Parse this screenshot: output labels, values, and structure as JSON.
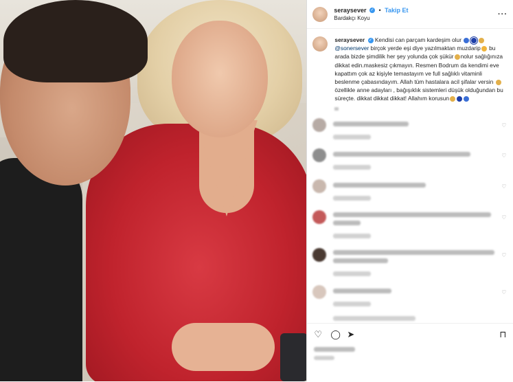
{
  "post": {
    "username": "seraysever",
    "follow_label": "Takip Et",
    "location": "Bardakçı Koyu",
    "caption_user": "seraysever",
    "caption_part1": "Kendisi can parçam kardeşim olur",
    "caption_mention": "@sonersever",
    "caption_part2": "birçok yerde eşi diye yazılmaktan muzdarip",
    "caption_part3": "bu arada bizde şimdilik her şey yolunda çok şükür",
    "caption_part4": "nolur sağlığınıza dikkat edin.maskesiz çıkmayın. Resmen Bodrum da kendimi eve kapattım çok az kişiyle temastayım ve full sağlıklı vitaminli beslenme çabasındayım. Allah tüm hastalara acil şifalar versin",
    "caption_part5": "özellikle anne adayları , bağışıklık sistemleri düşük olduğundan bu süreçte. dikkat dikkat dikkat! Allahım korusun"
  },
  "icons": {
    "more": "more-dots-icon",
    "verified": "verified-badge-icon",
    "like": "heart-icon",
    "comment": "comment-icon",
    "share": "share-icon",
    "save": "bookmark-icon"
  },
  "colors": {
    "accent": "#3897f0",
    "dress": "#c0232d",
    "mention": "#00376b"
  }
}
